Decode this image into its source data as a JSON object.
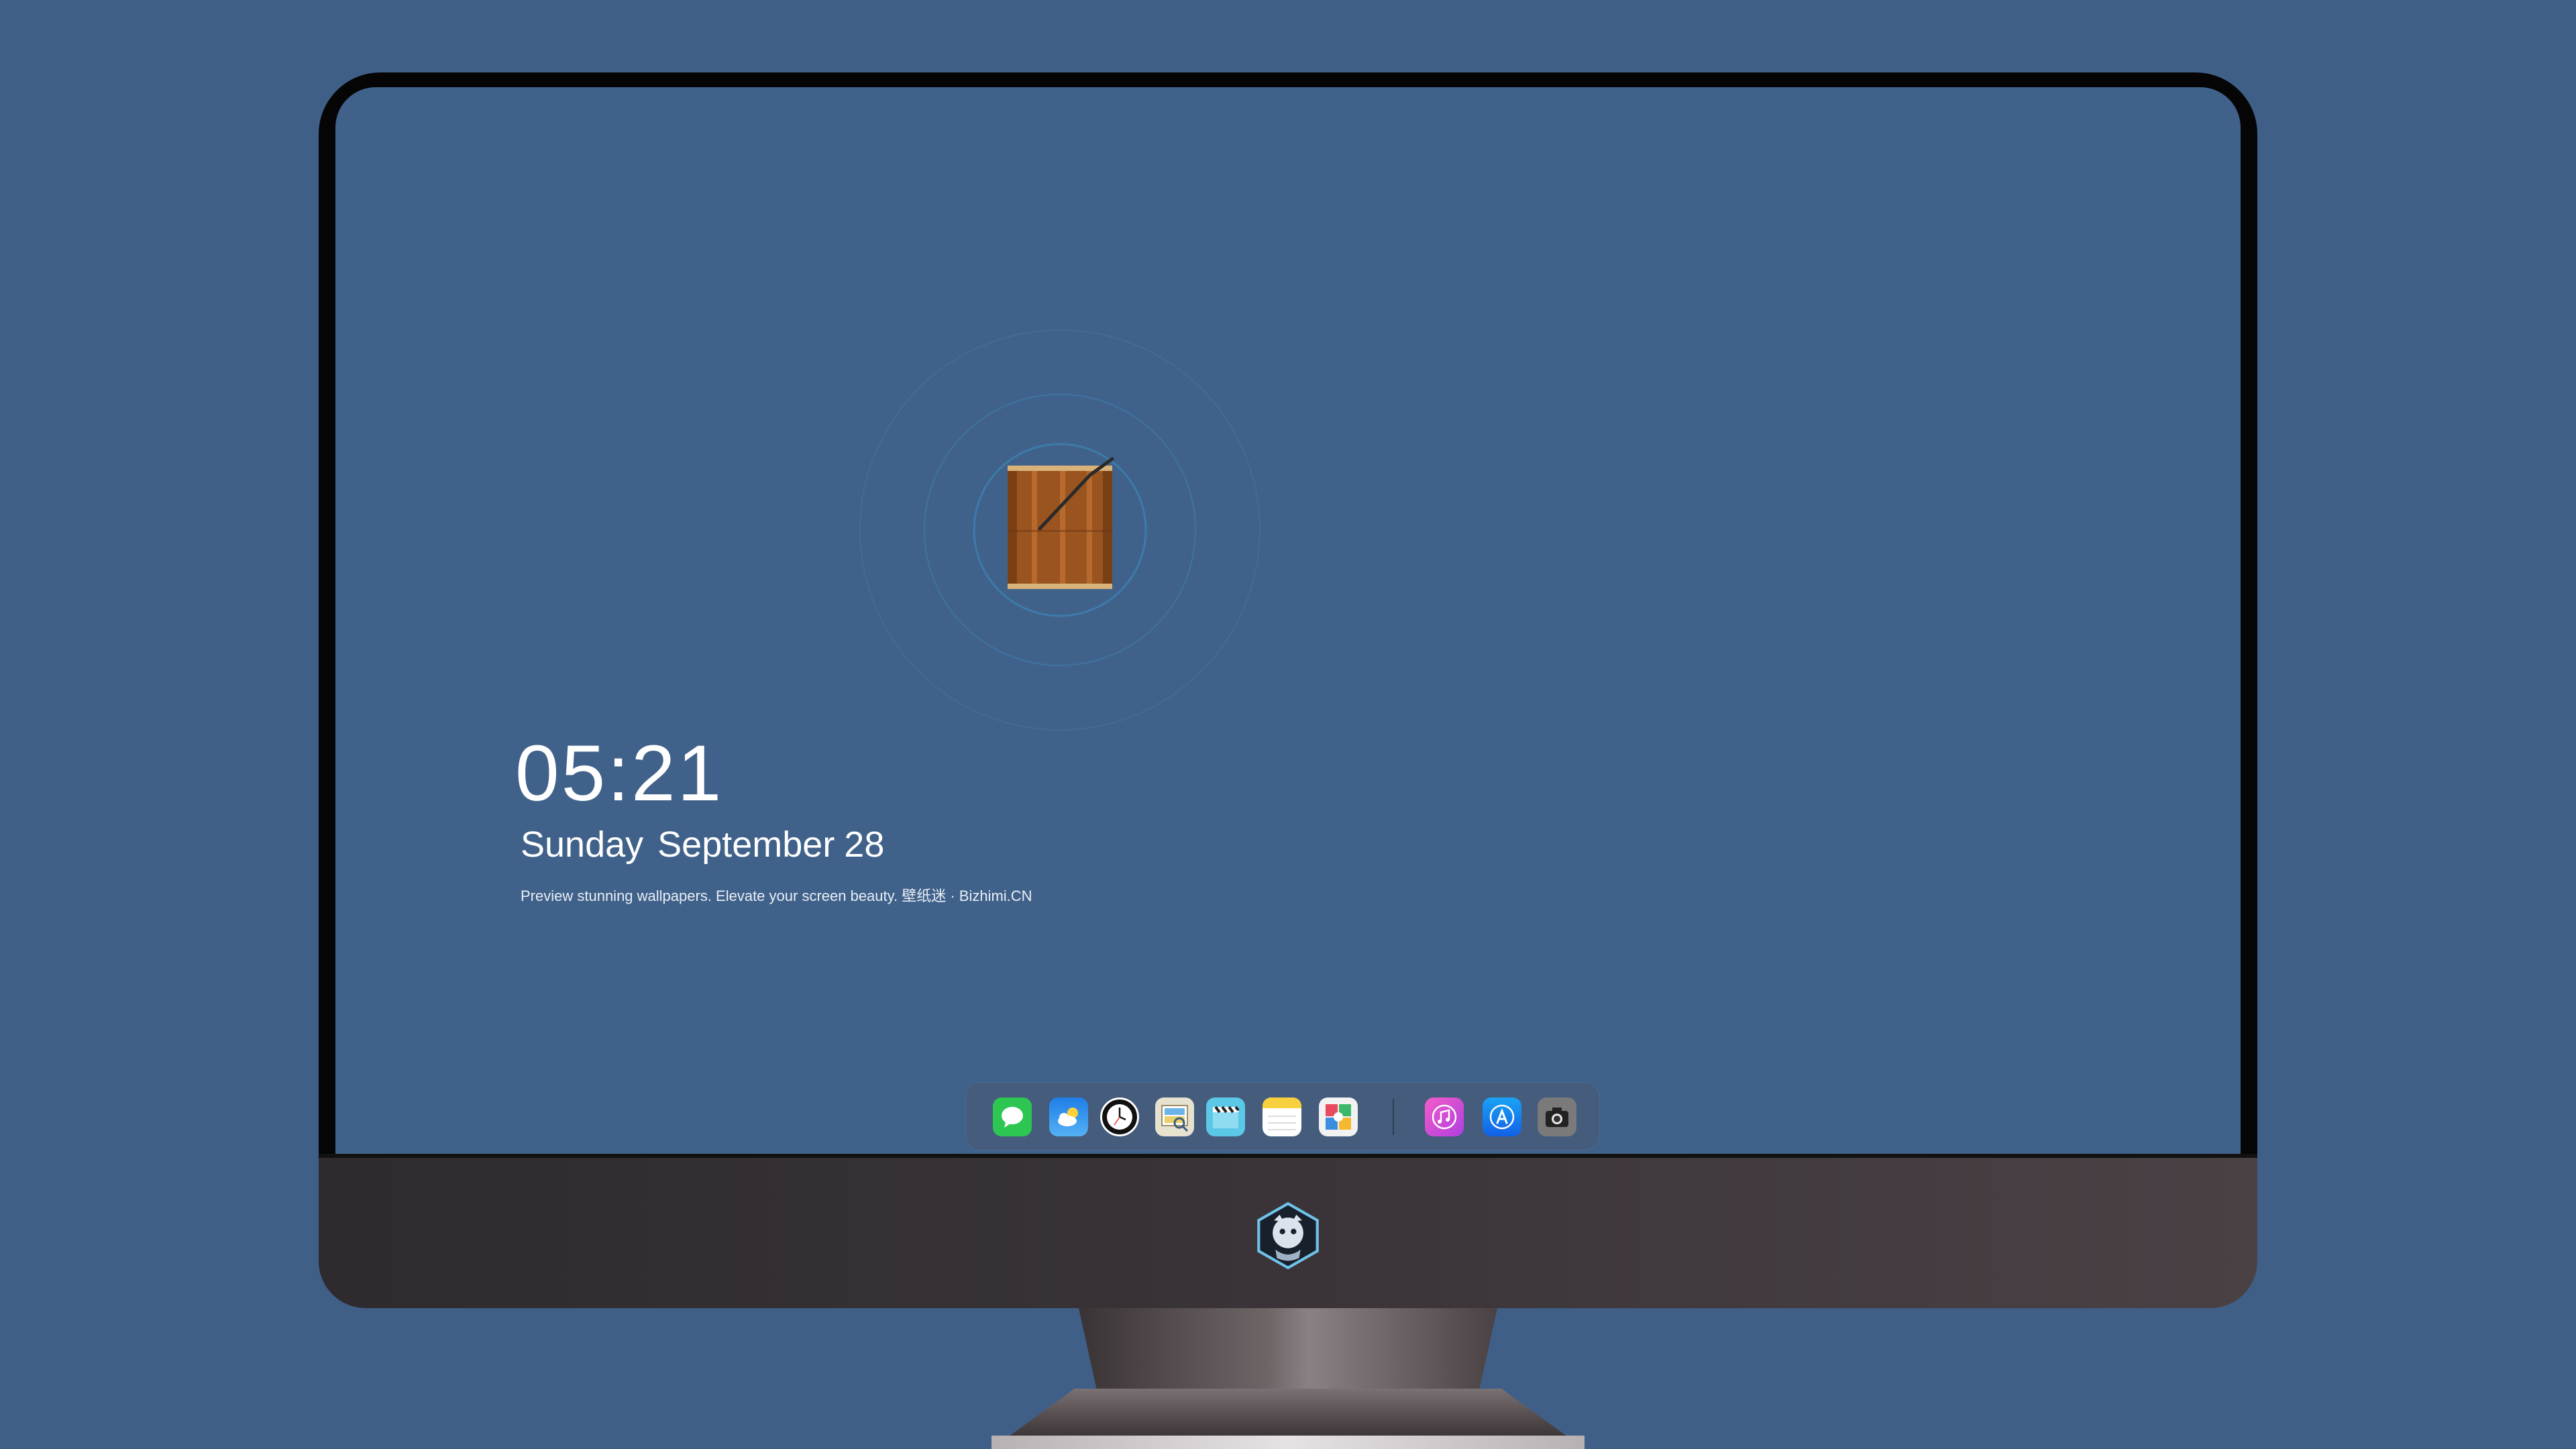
{
  "clock": {
    "time": "05:21",
    "weekday_month": "Sunday September",
    "day": "28",
    "tagline": "Preview stunning wallpapers. Elevate your screen beauty. 壁纸迷 · Bizhimi.CN"
  },
  "dock": {
    "apps": [
      {
        "name": "Messages",
        "icon": "messages-icon"
      },
      {
        "name": "Weather",
        "icon": "weather-icon"
      },
      {
        "name": "Clock",
        "icon": "clock-icon"
      },
      {
        "name": "Preview",
        "icon": "preview-icon"
      },
      {
        "name": "Clips",
        "icon": "clips-icon"
      },
      {
        "name": "Notes",
        "icon": "notes-icon"
      },
      {
        "name": "Photo Booth",
        "icon": "photo-booth-icon"
      },
      {
        "name": "iTunes",
        "icon": "itunes-icon"
      },
      {
        "name": "App Store",
        "icon": "app-store-icon"
      },
      {
        "name": "Screenshot",
        "icon": "camera-icon"
      }
    ]
  },
  "colors": {
    "background": "#3f5f87",
    "screen": "#40628a",
    "bezel": "#050505",
    "wood": "#a0581f"
  }
}
